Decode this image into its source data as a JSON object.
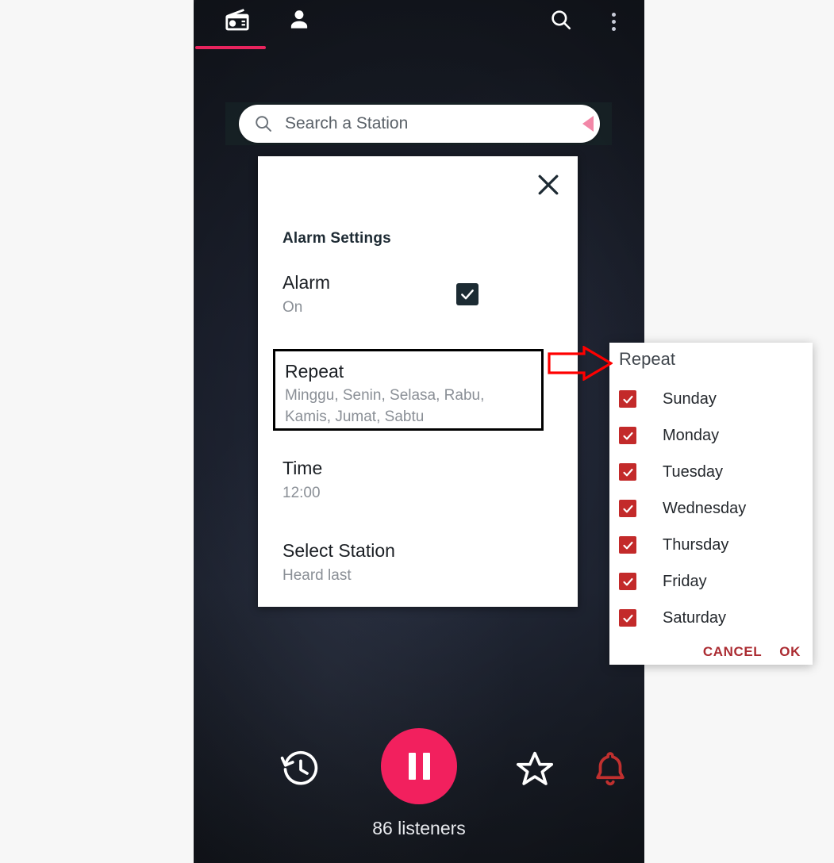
{
  "appbar": {
    "tabs": [
      {
        "name": "radio-tab",
        "icon": "radio-icon",
        "active": true
      },
      {
        "name": "profile-tab",
        "icon": "person-icon",
        "active": false
      }
    ],
    "search_icon": "search-icon",
    "overflow_icon": "more-vertical-icon",
    "indicator_color": "#e8245e"
  },
  "search": {
    "placeholder": "Search a Station",
    "icon": "search-icon",
    "value": ""
  },
  "dialog": {
    "title": "Alarm Settings",
    "close_icon": "close-icon",
    "rows": [
      {
        "title": "Alarm",
        "subtitle": "On",
        "checked": true
      },
      {
        "title": "Repeat",
        "subtitle": "Minggu, Senin, Selasa, Rabu, Kamis, Jumat, Sabtu",
        "highlighted": true
      },
      {
        "title": "Time",
        "subtitle": "12:00"
      },
      {
        "title": "Select Station",
        "subtitle": "Heard last"
      }
    ],
    "alarm_checkbox_color": "#1c2b33"
  },
  "repeat_panel": {
    "title": "Repeat",
    "checkbox_color": "#c32a2a",
    "days": [
      {
        "label": "Sunday",
        "checked": true
      },
      {
        "label": "Monday",
        "checked": true
      },
      {
        "label": "Tuesday",
        "checked": true
      },
      {
        "label": "Wednesday",
        "checked": true
      },
      {
        "label": "Thursday",
        "checked": true
      },
      {
        "label": "Friday",
        "checked": true
      },
      {
        "label": "Saturday",
        "checked": true
      }
    ],
    "cancel_label": "CANCEL",
    "ok_label": "OK",
    "action_color": "#ab2b31"
  },
  "annotation": {
    "arrow": "right-arrow-annotation",
    "color": "#ff0000"
  },
  "player": {
    "history_icon": "history-icon",
    "play_pause_icon": "pause-icon",
    "star_icon": "star-outline-icon",
    "alarm_bell_icon": "bell-icon",
    "play_button_color": "#f2205e",
    "bell_color": "#c0302f",
    "listeners": "86 listeners"
  }
}
